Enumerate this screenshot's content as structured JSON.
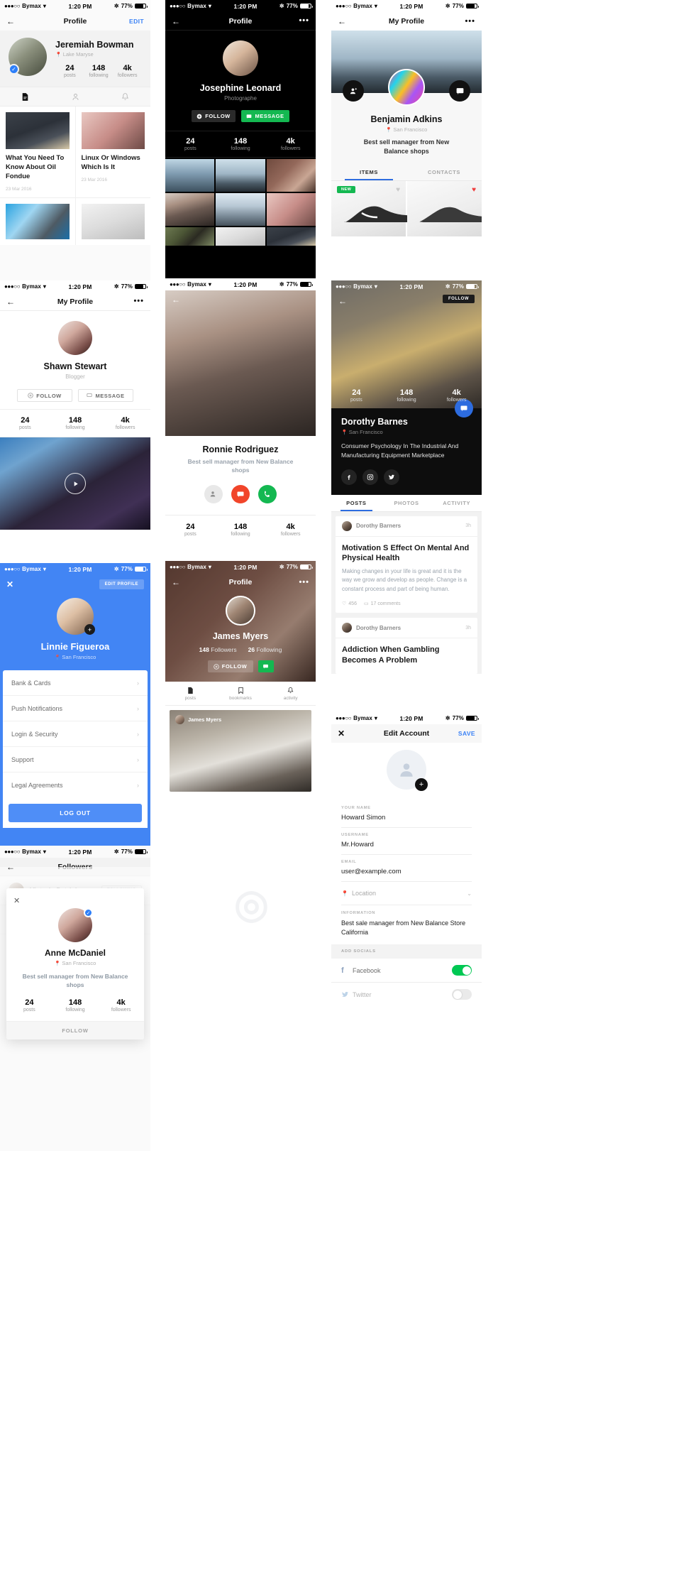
{
  "meta": {
    "status_carrier": "Bymax",
    "status_time": "1:20 PM",
    "status_battery": "77%"
  },
  "screens": {
    "jeremiah": {
      "nav_title": "Profile",
      "nav_action": "EDIT",
      "name": "Jeremiah Bowman",
      "location": "Lake Maryse",
      "stats": [
        {
          "num": "24",
          "label": "posts"
        },
        {
          "num": "148",
          "label": "following"
        },
        {
          "num": "4k",
          "label": "followers"
        }
      ],
      "tabs": [
        "articles-icon",
        "person-icon",
        "bell-icon"
      ],
      "articles": [
        {
          "title": "What You Need To Know About Oil Fondue",
          "date": "23 Mar 2016"
        },
        {
          "title": "Linux Or Windows Which Is It",
          "date": "23 Mar 2016"
        }
      ]
    },
    "josephine": {
      "nav_title": "Profile",
      "name": "Josephine Leonard",
      "subtitle": "Photographe",
      "follow_label": "FOLLOW",
      "message_label": "MESSAGE",
      "stats": [
        {
          "num": "24",
          "label": "posts"
        },
        {
          "num": "148",
          "label": "following"
        },
        {
          "num": "4k",
          "label": "followers"
        }
      ]
    },
    "benjamin": {
      "nav_title": "My Profile",
      "name": "Benjamin Adkins",
      "location": "San Francisco",
      "bio": "Best sell manager from New Balance shops",
      "tabs": [
        {
          "label": "ITEMS",
          "active": true
        },
        {
          "label": "CONTACTS",
          "active": false
        }
      ],
      "badge_new": "NEW"
    },
    "shawn": {
      "nav_title": "My Profile",
      "name": "Shawn Stewart",
      "subtitle": "Blogger",
      "follow_label": "FOLLOW",
      "message_label": "MESSAGE",
      "stats": [
        {
          "num": "24",
          "label": "posts"
        },
        {
          "num": "148",
          "label": "following"
        },
        {
          "num": "4k",
          "label": "followers"
        }
      ]
    },
    "ronnie": {
      "name": "Ronnie Rodriguez",
      "bio": "Best sell manager from New Balance shops",
      "stats": [
        {
          "num": "24",
          "label": "posts"
        },
        {
          "num": "148",
          "label": "following"
        },
        {
          "num": "4k",
          "label": "followers"
        }
      ]
    },
    "dorothy": {
      "follow_label": "FOLLOW",
      "name": "Dorothy Barnes",
      "location": "San Francisco",
      "bio": "Consumer Psychology In The Industrial And Manufacturing Equipment Marketplace",
      "socials": [
        "facebook-icon",
        "instagram-icon",
        "twitter-icon"
      ],
      "stats": [
        {
          "num": "24",
          "label": "posts"
        },
        {
          "num": "148",
          "label": "following"
        },
        {
          "num": "4k",
          "label": "followers"
        }
      ],
      "tabs": [
        {
          "label": "POSTS",
          "active": true
        },
        {
          "label": "PHOTOS",
          "active": false
        },
        {
          "label": "ACTIVITY",
          "active": false
        }
      ],
      "posts": [
        {
          "author": "Dorothy Barners",
          "time": "3h",
          "title": "Motivation S Effect On Mental And Physical Health",
          "body": "Making changes in your life is great and it is the way we grow and develop as people. Change is a constant process and part of being human.",
          "likes": "456",
          "comments": "17 comments"
        },
        {
          "author": "Dorothy Barners",
          "time": "3h",
          "title": "Addiction When Gambling Becomes A Problem",
          "body": "",
          "likes": "",
          "comments": ""
        }
      ]
    },
    "linnie": {
      "edit_label": "EDIT PROFILE",
      "name": "Linnie Figueroa",
      "location": "San Francisco",
      "menu": [
        "Bank & Cards",
        "Push Notifications",
        "Login & Security",
        "Support",
        "Legal Agreements"
      ],
      "logout_label": "LOG OUT",
      "accent": "#4285f4"
    },
    "james": {
      "nav_title": "Profile",
      "name": "James Myers",
      "followers_count": "148",
      "followers_label": "Followers",
      "following_count": "26",
      "following_label": "Following",
      "follow_label": "FOLLOW",
      "tabs": [
        {
          "label": "posts",
          "icon": "doc-icon"
        },
        {
          "label": "bookmarks",
          "icon": "bookmark-icon"
        },
        {
          "label": "activity",
          "icon": "bell-icon"
        }
      ],
      "card_caption": "James Myers"
    },
    "edit_account": {
      "nav_title": "Edit Account",
      "save_label": "SAVE",
      "fields": [
        {
          "label": "YOUR NAME",
          "value": "Howard Simon"
        },
        {
          "label": "USERNAME",
          "value": "Mr.Howard"
        },
        {
          "label": "EMAIL",
          "value": "user@example.com"
        }
      ],
      "location_label": "Location",
      "info_label": "INFORMATION",
      "info_value": "Best sale manager from New Balance Store California",
      "socials_header": "ADD SOCIALS",
      "social_rows": [
        {
          "name": "Facebook",
          "icon": "facebook-icon",
          "on": true
        },
        {
          "name": "Twitter",
          "icon": "twitter-icon",
          "on": false
        }
      ],
      "toggle_on_color": "#00c853"
    },
    "followers": {
      "nav_title": "Followers",
      "rows": [
        {
          "name": "Victoria Patrick",
          "action": "FOLLOWING"
        }
      ],
      "modal": {
        "name": "Anne McDaniel",
        "location": "San Francisco",
        "bio": "Best sell manager from New Balance shops",
        "stats": [
          {
            "num": "24",
            "label": "posts"
          },
          {
            "num": "148",
            "label": "following"
          },
          {
            "num": "4k",
            "label": "followers"
          }
        ],
        "follow_label": "FOLLOW"
      }
    }
  }
}
